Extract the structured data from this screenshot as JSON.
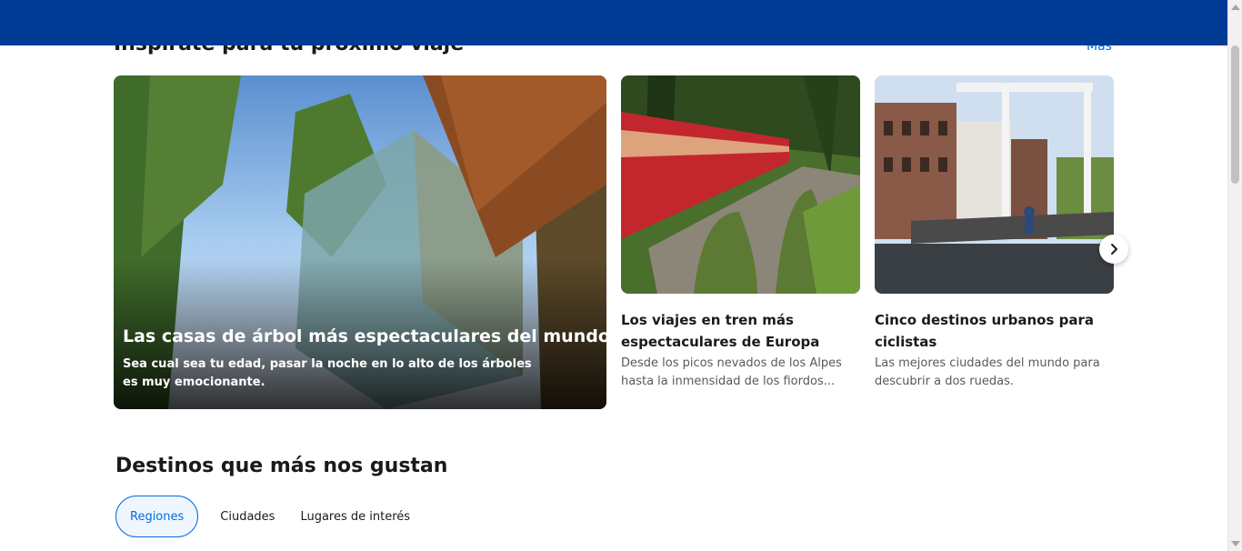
{
  "inspiration": {
    "title": "Inspírate para tu próximo viaje",
    "more_label": "Más",
    "featured": {
      "title": "Las casas de árbol más espectaculares del mundo",
      "description": "Sea cual sea tu edad, pasar la noche en lo alto de los árboles es muy emocionante."
    },
    "cards": [
      {
        "title": "Los viajes en tren más espectaculares de Europa",
        "description": "Desde los picos nevados de los Alpes hasta la inmensidad de los fiordos..."
      },
      {
        "title": "Cinco destinos urbanos para ciclistas",
        "description": "Las mejores ciudades del mundo para descubrir a dos ruedas."
      }
    ],
    "next_icon": "chevron-right-icon"
  },
  "destinations": {
    "title": "Destinos que más nos gustan",
    "tabs": [
      {
        "label": "Regiones",
        "active": true
      },
      {
        "label": "Ciudades",
        "active": false
      },
      {
        "label": "Lugares de interés",
        "active": false
      }
    ]
  },
  "colors": {
    "header": "#003b95",
    "link": "#006ce4",
    "active_tab_bg": "#f0f6fd"
  }
}
